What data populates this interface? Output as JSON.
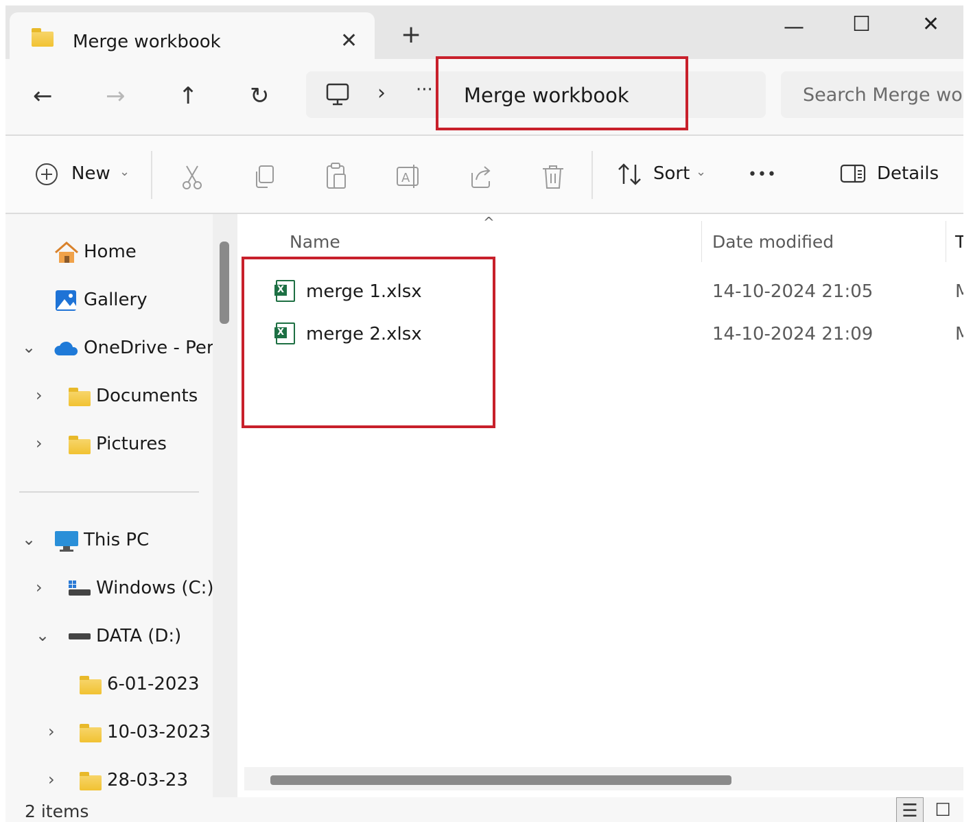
{
  "window": {
    "tab_title": "Merge workbook",
    "tab_close": "✕",
    "new_tab": "+",
    "minimize": "—",
    "maximize": "☐",
    "close": "✕"
  },
  "nav": {
    "back": "←",
    "forward": "→",
    "up": "↑",
    "refresh": "↻",
    "breadcrumb_chevron": "›",
    "breadcrumb_more": "···"
  },
  "address": {
    "current_folder": "Merge workbook"
  },
  "search": {
    "placeholder": "Search Merge wo"
  },
  "toolbar": {
    "new_label": "New",
    "sort_label": "Sort",
    "more": "•••",
    "details_label": "Details",
    "icons": [
      "plus-circle-icon",
      "cut-icon",
      "copy-icon",
      "paste-icon",
      "rename-icon",
      "share-icon",
      "delete-icon",
      "sort-icon",
      "details-pane-icon"
    ]
  },
  "sidebar": {
    "items": [
      {
        "label": "Home",
        "icon": "home-icon"
      },
      {
        "label": "Gallery",
        "icon": "gallery-icon"
      },
      {
        "label": "OneDrive - Perso",
        "icon": "cloud-icon"
      },
      {
        "label": "Documents",
        "icon": "folder-icon"
      },
      {
        "label": "Pictures",
        "icon": "folder-icon"
      },
      {
        "label": "This PC",
        "icon": "monitor-icon"
      },
      {
        "label": "Windows (C:)",
        "icon": "drive-icon"
      },
      {
        "label": "DATA (D:)",
        "icon": "drive-icon"
      },
      {
        "label": "6-01-2023",
        "icon": "folder-icon"
      },
      {
        "label": "10-03-2023",
        "icon": "folder-icon"
      },
      {
        "label": "28-03-23",
        "icon": "folder-icon"
      }
    ]
  },
  "columns": {
    "name": "Name",
    "date_modified": "Date modified",
    "type_partial": "T"
  },
  "files": [
    {
      "name": "merge 1.xlsx",
      "date": "14-10-2024 21:05",
      "type_partial": "M"
    },
    {
      "name": "merge 2.xlsx",
      "date": "14-10-2024 21:09",
      "type_partial": "M"
    }
  ],
  "excel_badge": "X",
  "status": {
    "item_count": "2 items"
  },
  "colors": {
    "highlight": "#c8202b",
    "excel_green": "#1d6f42",
    "folder_yellow": "#f1c232"
  }
}
